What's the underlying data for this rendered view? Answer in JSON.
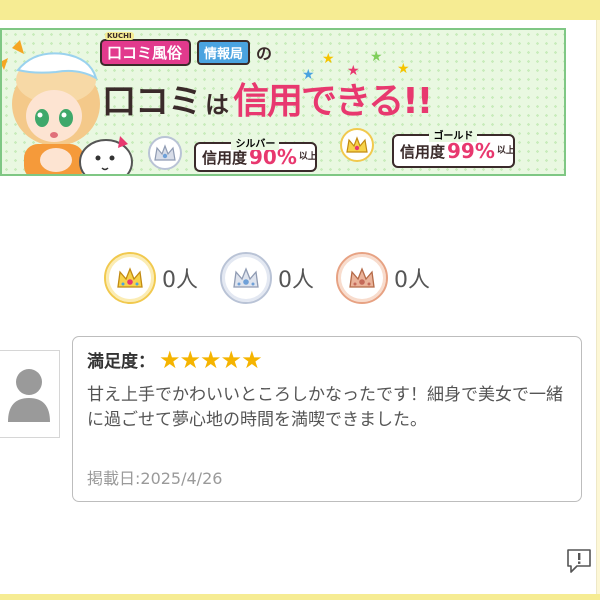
{
  "banner": {
    "logo_mark": "KUCHI",
    "logo_text": "口コミ風俗",
    "logo_sub": "情報局",
    "logo_no": "の",
    "headline_a": "口コミ",
    "headline_b": "は",
    "headline_c": "信用できる!!",
    "silver": {
      "tag": "シルバー",
      "label": "信用度",
      "percent": "90%",
      "suffix": "以上"
    },
    "gold": {
      "tag": "ゴールド",
      "label": "信用度",
      "percent": "99%",
      "suffix": "以上"
    }
  },
  "crowns": [
    {
      "name": "gold",
      "count": "0人"
    },
    {
      "name": "silver",
      "count": "0人"
    },
    {
      "name": "bronze",
      "count": "0人"
    }
  ],
  "review": {
    "rating_label": "満足度：",
    "stars": "★★★★★",
    "rating": 5,
    "text": "甘え上手でかわいいところしかなったです！細身で美女で一緒に過ごせて夢心地の時間を満喫できました。",
    "date": "掲載日:2025/4/26"
  },
  "colors": {
    "accent_pink": "#e8386f",
    "star": "#f5b400",
    "banner_bg": "#e9f8e1",
    "page_bg": "#fdf7d6"
  },
  "icons": [
    "crown-gold-icon",
    "crown-silver-icon",
    "crown-bronze-icon",
    "user-avatar-icon",
    "report-icon"
  ]
}
